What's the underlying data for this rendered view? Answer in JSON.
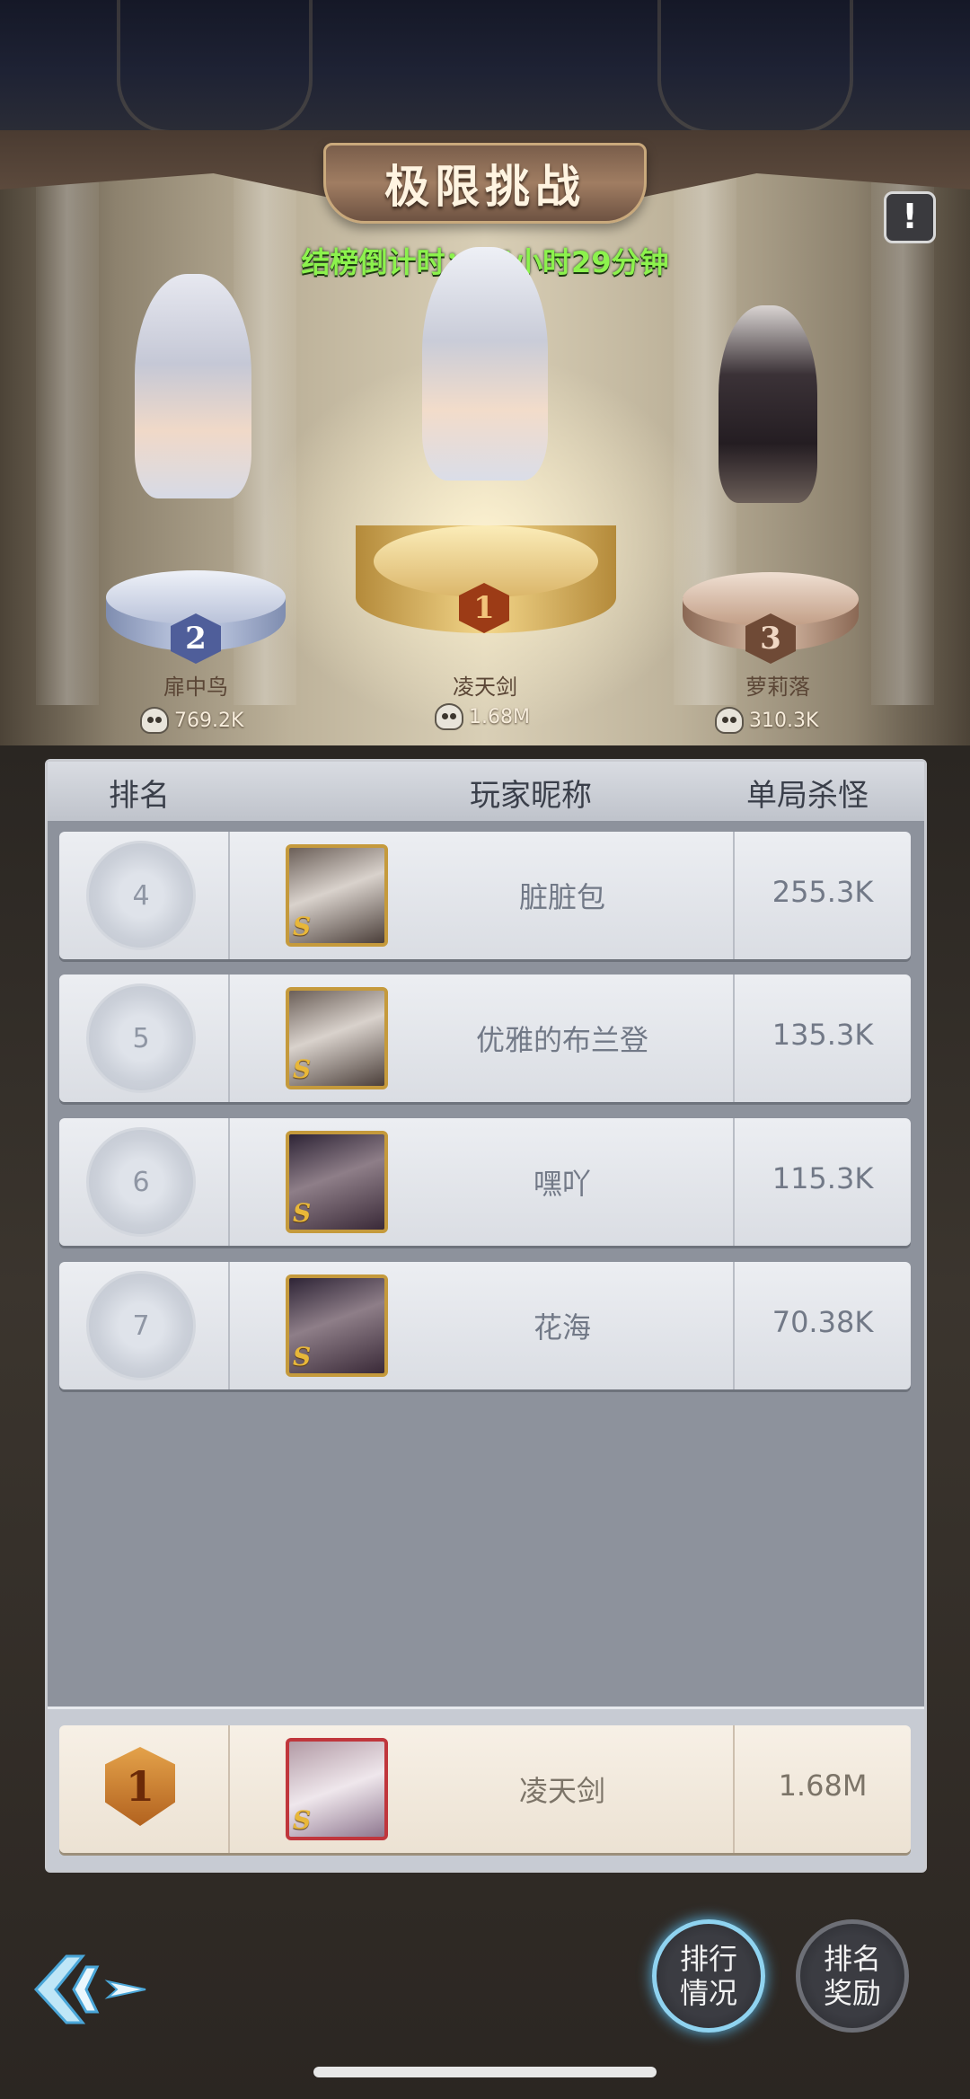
{
  "header": {
    "title": "极限挑战",
    "countdown": "结榜倒计时：14小时29分钟",
    "info_icon": "exclamation-icon"
  },
  "podium": [
    {
      "rank": "2",
      "name": "扉中鸟",
      "score": "769.2K"
    },
    {
      "rank": "1",
      "name": "凌天剑",
      "score": "1.68M"
    },
    {
      "rank": "3",
      "name": "萝莉落",
      "score": "310.3K"
    }
  ],
  "table": {
    "headers": {
      "rank": "排名",
      "name": "玩家昵称",
      "kills": "单局杀怪"
    },
    "rows": [
      {
        "rank": "4",
        "name": "脏脏包",
        "kills": "255.3K",
        "avatar_grade": "S"
      },
      {
        "rank": "5",
        "name": "优雅的布兰登",
        "kills": "135.3K",
        "avatar_grade": "S"
      },
      {
        "rank": "6",
        "name": "嘿吖",
        "kills": "115.3K",
        "avatar_grade": "S"
      },
      {
        "rank": "7",
        "name": "花海",
        "kills": "70.38K",
        "avatar_grade": "S"
      }
    ],
    "self": {
      "rank": "1",
      "name": "凌天剑",
      "kills": "1.68M",
      "avatar_grade": "S"
    }
  },
  "footer": {
    "back_icon": "back-arrow-icon",
    "btn_ranking": "排行情况",
    "btn_rewards": "排名奖励"
  },
  "colors": {
    "countdown": "#8cf24d",
    "gold": "#c59a3c",
    "active_glow": "#5ab8e8"
  }
}
